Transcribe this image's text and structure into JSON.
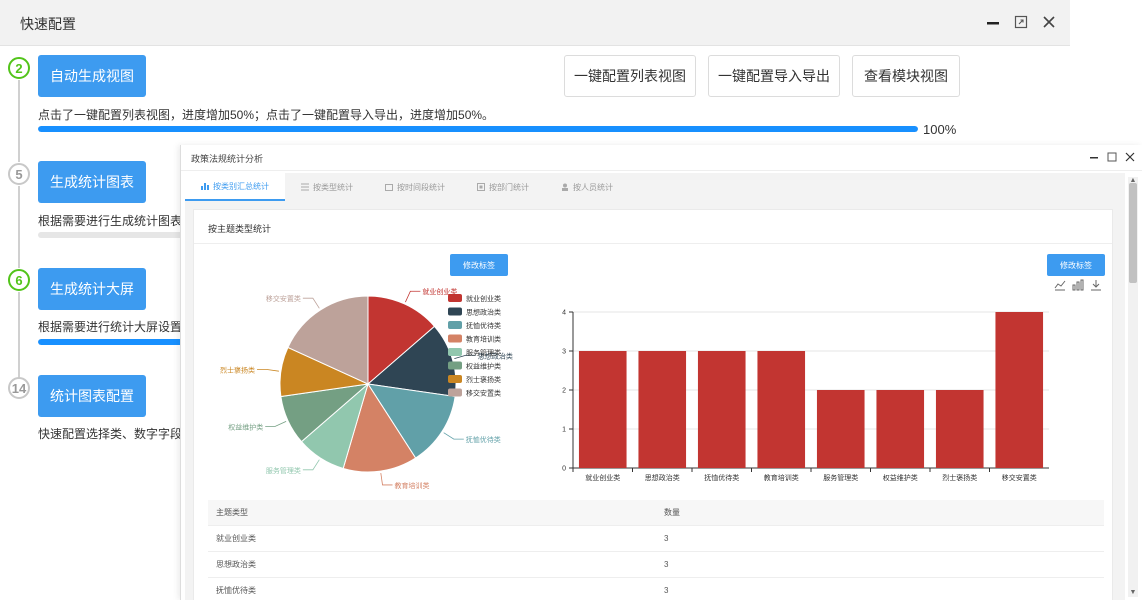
{
  "window": {
    "title": "快速配置"
  },
  "steps": [
    {
      "num": "2",
      "label": "自动生成视图",
      "desc": "点击了一键配置列表视图，进度增加50%；点击了一键配置导入导出，进度增加50%。",
      "progress_pct": 100,
      "pct_label": "100%"
    },
    {
      "num": "5",
      "label": "生成统计图表",
      "desc": "根据需要进行生成统计图表配置"
    },
    {
      "num": "6",
      "label": "生成统计大屏",
      "desc": "根据需要进行统计大屏设置，不"
    },
    {
      "num": "14",
      "label": "统计图表配置",
      "desc": "快速配置选择类、数字字段为统"
    }
  ],
  "top_buttons": [
    "一键配置列表视图",
    "一键配置导入导出",
    "查看模块视图"
  ],
  "inner": {
    "title": "政策法规统计分析",
    "tabs": [
      "按类别汇总统计",
      "按类型统计",
      "按时间段统计",
      "按部门统计",
      "按人员统计"
    ],
    "card_title": "按主题类型统计",
    "tag_button": "修改标签",
    "table": {
      "headers": [
        "主题类型",
        "数量"
      ],
      "rows": [
        [
          "就业创业类",
          "3"
        ],
        [
          "思想政治类",
          "3"
        ],
        [
          "抚恤优待类",
          "3"
        ]
      ]
    }
  },
  "chart_data": [
    {
      "type": "pie",
      "categories": [
        "就业创业类",
        "思想政治类",
        "抚恤优待类",
        "教育培训类",
        "服务管理类",
        "权益维护类",
        "烈士褒扬类",
        "移交安置类"
      ],
      "values": [
        3,
        3,
        3,
        3,
        2,
        2,
        2,
        4
      ],
      "colors": [
        "#c23531",
        "#2f4554",
        "#61a0a8",
        "#d48265",
        "#91c7ae",
        "#749f83",
        "#ca8622",
        "#bda29a"
      ],
      "legend": "right"
    },
    {
      "type": "bar",
      "categories": [
        "就业创业类",
        "思想政治类",
        "抚恤优待类",
        "教育培训类",
        "服务管理类",
        "权益维护类",
        "烈士褒扬类",
        "移交安置类"
      ],
      "values": [
        3,
        3,
        3,
        3,
        2,
        2,
        2,
        4
      ],
      "ylim": [
        0,
        4
      ],
      "yticks": [
        0,
        1,
        2,
        3,
        4
      ],
      "color": "#c23531",
      "grid": true
    }
  ]
}
